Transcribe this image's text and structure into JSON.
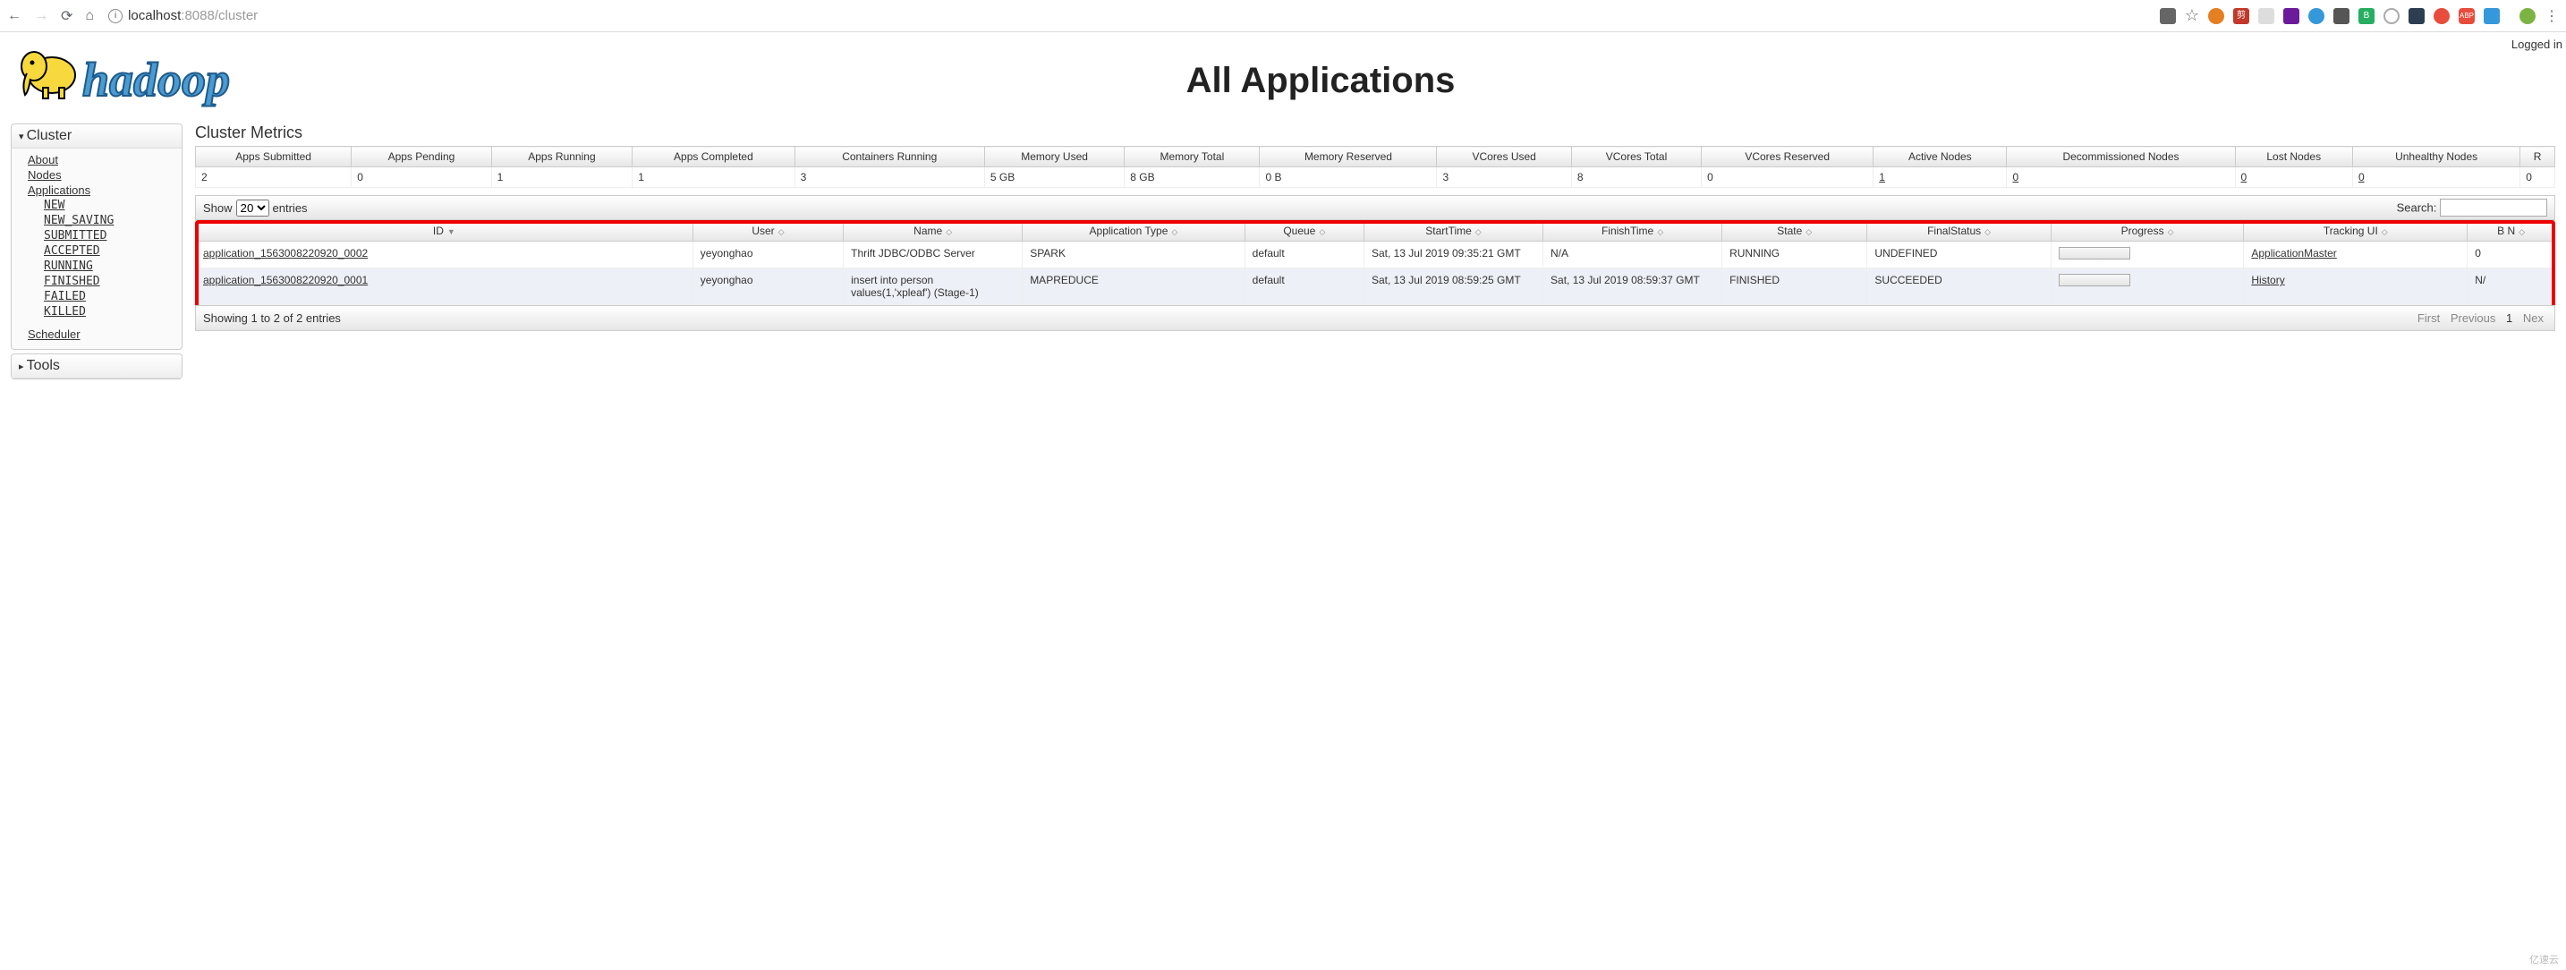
{
  "browser": {
    "url_host": "localhost",
    "url_port_path": ":8088/cluster"
  },
  "header": {
    "logged_in": "Logged in",
    "logo_text": "hadoop",
    "title": "All Applications"
  },
  "sidebar": {
    "cluster_label": "Cluster",
    "about": "About",
    "nodes": "Nodes",
    "applications": "Applications",
    "states": [
      "NEW",
      "NEW_SAVING",
      "SUBMITTED",
      "ACCEPTED",
      "RUNNING",
      "FINISHED",
      "FAILED",
      "KILLED"
    ],
    "scheduler": "Scheduler",
    "tools_label": "Tools"
  },
  "metrics": {
    "title": "Cluster Metrics",
    "headers": [
      "Apps Submitted",
      "Apps Pending",
      "Apps Running",
      "Apps Completed",
      "Containers Running",
      "Memory Used",
      "Memory Total",
      "Memory Reserved",
      "VCores Used",
      "VCores Total",
      "VCores Reserved",
      "Active Nodes",
      "Decommissioned Nodes",
      "Lost Nodes",
      "Unhealthy Nodes",
      "R"
    ],
    "values": [
      "2",
      "0",
      "1",
      "1",
      "3",
      "5 GB",
      "8 GB",
      "0 B",
      "3",
      "8",
      "0",
      "1",
      "0",
      "0",
      "0",
      "0"
    ]
  },
  "dt": {
    "show_label": "Show",
    "entries_label": "entries",
    "select_value": "20",
    "search_label": "Search:",
    "info": "Showing 1 to 2 of 2 entries",
    "first": "First",
    "prev": "Previous",
    "page": "1",
    "next": "Nex"
  },
  "apps": {
    "headers": [
      "ID",
      "User",
      "Name",
      "Application Type",
      "Queue",
      "StartTime",
      "FinishTime",
      "State",
      "FinalStatus",
      "Progress",
      "Tracking UI",
      "B N"
    ],
    "rows": [
      {
        "id": "application_1563008220920_0002",
        "user": "yeyonghao",
        "name": "Thrift JDBC/ODBC Server",
        "type": "SPARK",
        "queue": "default",
        "start": "Sat, 13 Jul 2019 09:35:21 GMT",
        "finish": "N/A",
        "state": "RUNNING",
        "final": "UNDEFINED",
        "track": "ApplicationMaster",
        "bn": "0"
      },
      {
        "id": "application_1563008220920_0001",
        "user": "yeyonghao",
        "name": "insert into person values(1,'xpleaf') (Stage-1)",
        "type": "MAPREDUCE",
        "queue": "default",
        "start": "Sat, 13 Jul 2019 08:59:25 GMT",
        "finish": "Sat, 13 Jul 2019 08:59:37 GMT",
        "state": "FINISHED",
        "final": "SUCCEEDED",
        "track": "History",
        "bn": "N/"
      }
    ]
  },
  "watermark": "亿速云"
}
